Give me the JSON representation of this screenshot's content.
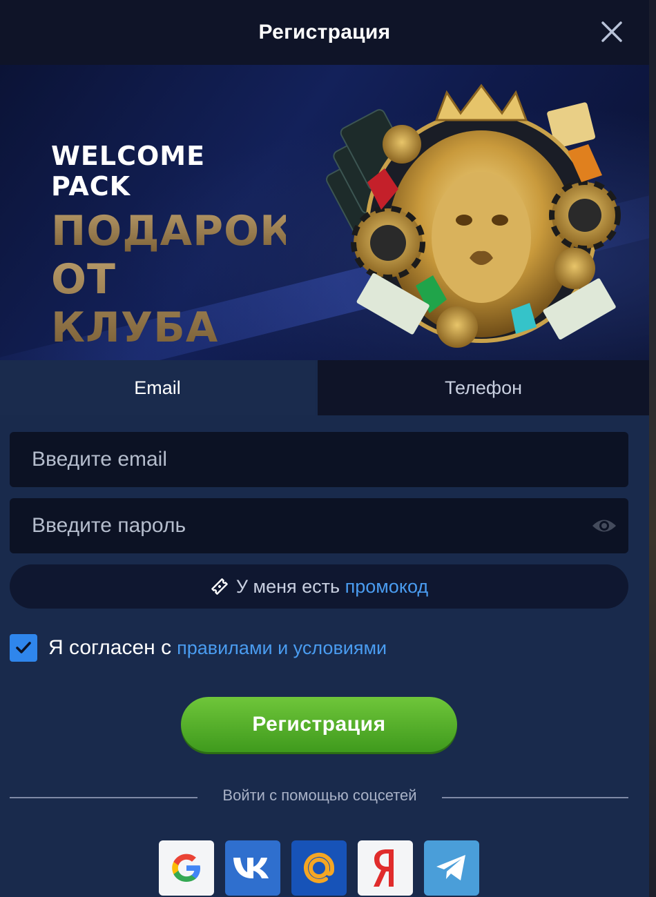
{
  "header": {
    "title": "Регистрация"
  },
  "banner": {
    "welcome": "WELCOME PACK",
    "gift_line1": "ПОДАРОК",
    "gift_line2": "ОТ КЛУБА"
  },
  "tabs": [
    {
      "label": "Email",
      "active": true
    },
    {
      "label": "Телефон",
      "active": false
    }
  ],
  "form": {
    "email_placeholder": "Введите email",
    "email_value": "",
    "password_placeholder": "Введите пароль",
    "password_value": "",
    "promo_prefix": "У меня есть",
    "promo_link": "промокод",
    "agree_text": "Я согласен с",
    "agree_link": "правилами и условиями",
    "agree_checked": true,
    "submit_label": "Регистрация"
  },
  "social": {
    "caption": "Войти с помощью соцсетей",
    "items": [
      {
        "name": "google",
        "icon": "google-icon"
      },
      {
        "name": "vk",
        "icon": "vk-icon"
      },
      {
        "name": "mail",
        "icon": "mail-at-icon"
      },
      {
        "name": "yandex",
        "icon": "yandex-icon"
      },
      {
        "name": "telegram",
        "icon": "telegram-icon"
      }
    ]
  },
  "colors": {
    "background": "#192a4c",
    "header": "#0f1428",
    "field": "#0c1224",
    "link": "#4a9cf0",
    "accent_green": "#4fa825",
    "checkbox": "#2f86ec"
  }
}
